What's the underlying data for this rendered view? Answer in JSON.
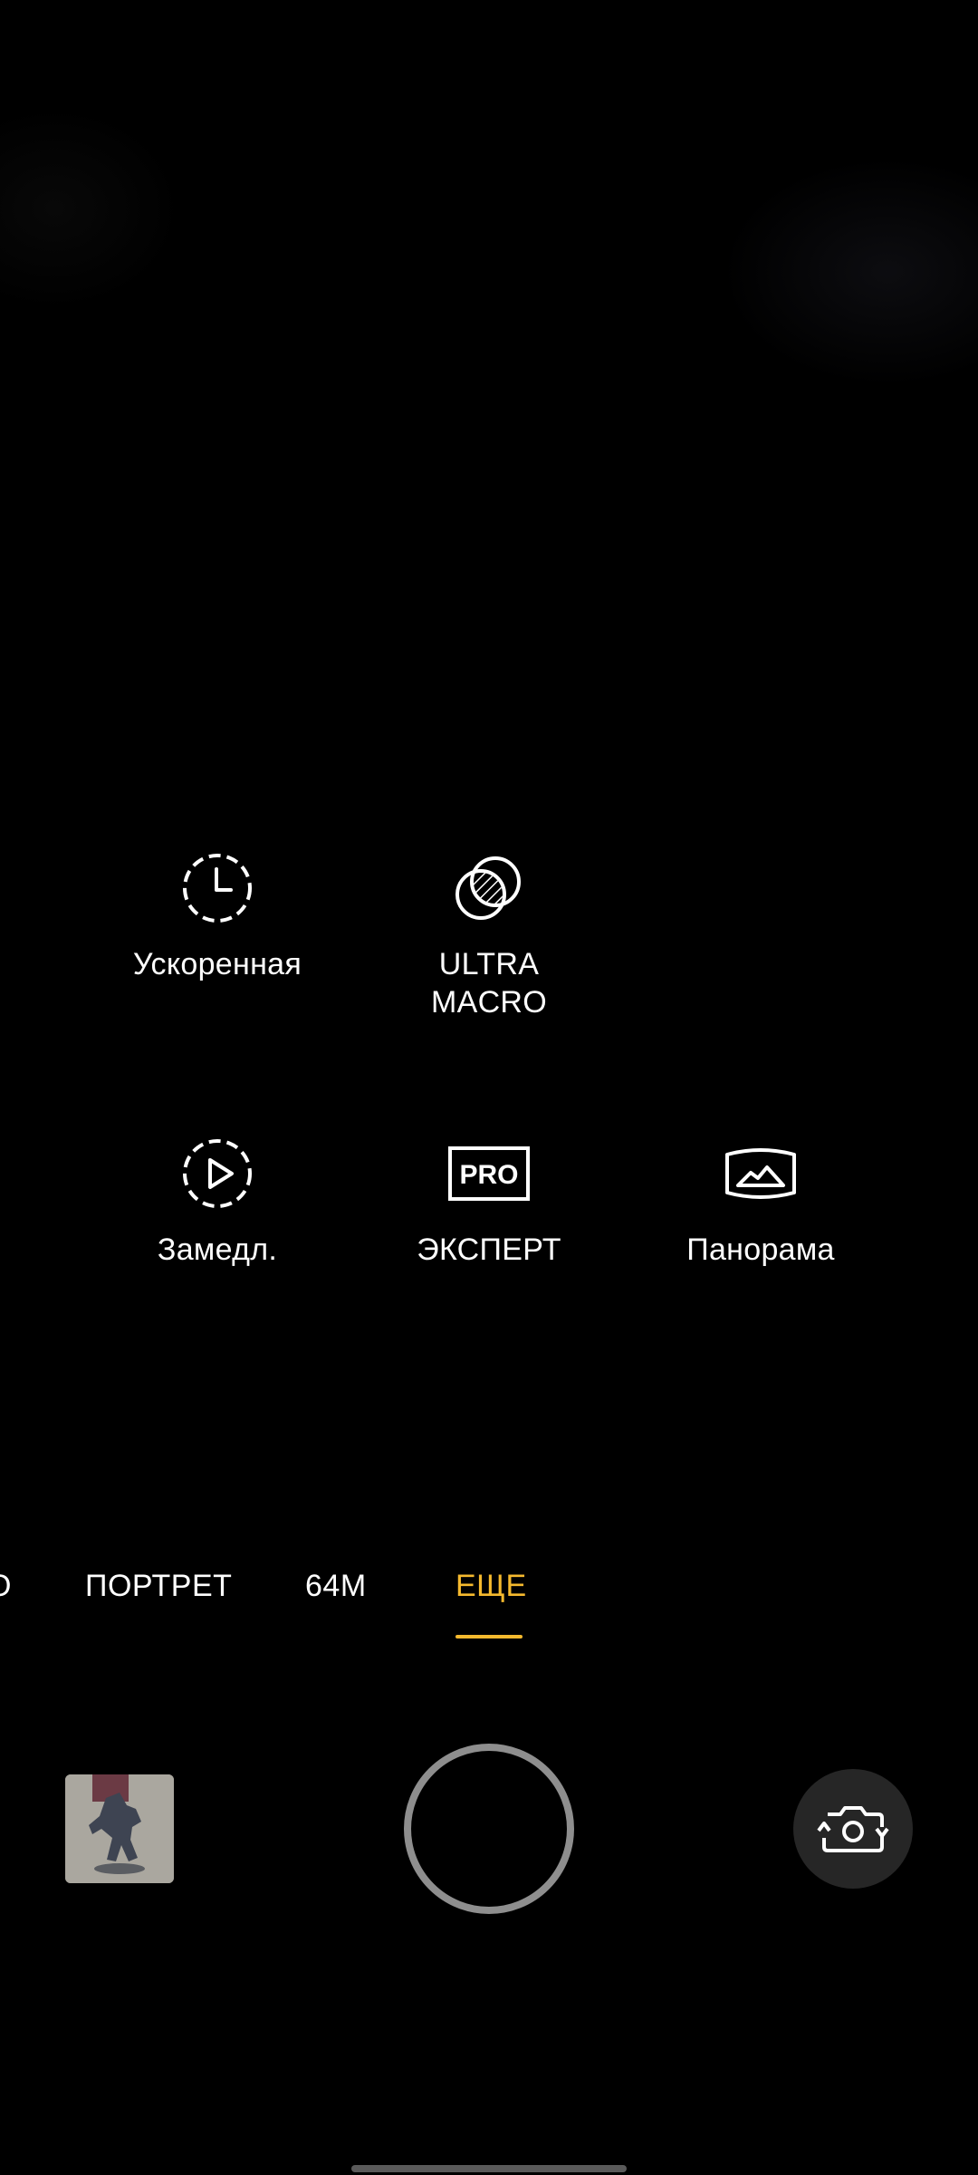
{
  "modes": [
    {
      "label": "Ускоренная",
      "icon": "timelapse-icon"
    },
    {
      "label": "ULTRA\nMACRO",
      "icon": "ultra-macro-icon"
    },
    {
      "label": "Замедл.",
      "icon": "slow-motion-icon"
    },
    {
      "label": "ЭКСПЕРТ",
      "icon": "pro-icon"
    },
    {
      "label": "Панорама",
      "icon": "panorama-icon"
    }
  ],
  "tabs": {
    "partial": "O",
    "portrait": "ПОРТРЕТ",
    "m64": "64M",
    "more": "ЕЩЕ",
    "active": "ЕЩЕ"
  },
  "colors": {
    "accent": "#f5b92e",
    "background": "#000000",
    "shutter_ring": "#8e8e8e"
  },
  "controls": {
    "gallery_icon": "gallery-thumbnail",
    "shutter_icon": "shutter-button",
    "flip_icon": "camera-flip-icon"
  }
}
